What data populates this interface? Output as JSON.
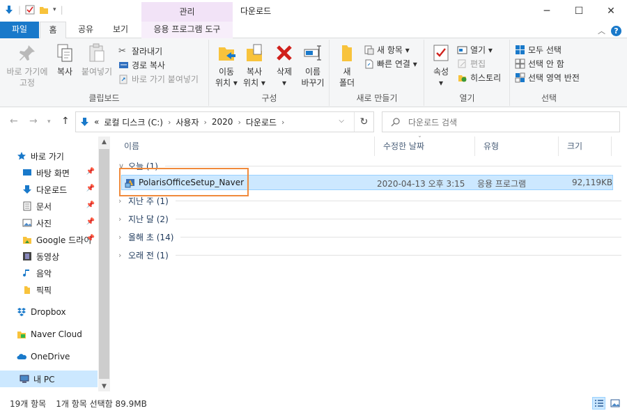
{
  "titlebar": {
    "title": "다운로드",
    "context_tab_header": "관리",
    "controls": {
      "minimize": "─",
      "maximize": "☐",
      "close": "✕"
    }
  },
  "tabs": [
    {
      "label": "파일"
    },
    {
      "label": "홈"
    },
    {
      "label": "공유"
    },
    {
      "label": "보기"
    },
    {
      "label": "응용 프로그램 도구"
    }
  ],
  "ribbon": {
    "clipboard": {
      "label": "클립보드",
      "pin_quick_access": [
        "바로 가기에",
        "고정"
      ],
      "copy": "복사",
      "paste": "붙여넣기",
      "cut": "잘라내기",
      "copy_path": "경로 복사",
      "paste_shortcut": "바로 가기 붙여넣기"
    },
    "organize": {
      "label": "구성",
      "move_to": [
        "이동",
        "위치 ▾"
      ],
      "copy_to": [
        "복사",
        "위치 ▾"
      ],
      "delete": [
        "삭제",
        "▾"
      ],
      "rename": [
        "이름",
        "바꾸기"
      ]
    },
    "new": {
      "label": "새로 만들기",
      "new_folder": [
        "새",
        "폴더"
      ],
      "new_item": "새 항목 ▾",
      "easy_access": "빠른 연결 ▾"
    },
    "open": {
      "label": "열기",
      "properties": [
        "속성",
        "▾"
      ],
      "open": "열기 ▾",
      "edit": "편집",
      "history": "히스토리"
    },
    "select": {
      "label": "선택",
      "select_all": "모두 선택",
      "select_none": "선택 안 함",
      "invert": "선택 영역 반전"
    }
  },
  "address": {
    "path_prefix": "«",
    "crumbs": [
      "로컬 디스크 (C:)",
      "사용자",
      "2020",
      "다운로드"
    ],
    "search_placeholder": "다운로드 검색"
  },
  "nav": {
    "items": [
      {
        "label": "바로 가기",
        "icon": "star-icon",
        "pinned": false
      },
      {
        "label": "바탕 화면",
        "icon": "desktop-icon",
        "pinned": true
      },
      {
        "label": "다운로드",
        "icon": "download-icon",
        "pinned": true
      },
      {
        "label": "문서",
        "icon": "document-icon",
        "pinned": true
      },
      {
        "label": "사진",
        "icon": "picture-icon",
        "pinned": true
      },
      {
        "label": "Google 드라이",
        "icon": "folder-icon",
        "pinned": true
      },
      {
        "label": "동영상",
        "icon": "video-icon",
        "pinned": false
      },
      {
        "label": "음악",
        "icon": "music-icon",
        "pinned": false
      },
      {
        "label": "픽픽",
        "icon": "folder-icon",
        "pinned": false
      },
      {
        "label": "Dropbox",
        "icon": "dropbox-icon",
        "pinned": false
      },
      {
        "label": "Naver Cloud",
        "icon": "folder-icon",
        "pinned": false
      },
      {
        "label": "OneDrive",
        "icon": "cloud-icon",
        "pinned": false
      },
      {
        "label": "내 PC",
        "icon": "pc-icon",
        "pinned": false
      }
    ]
  },
  "columns": [
    "이름",
    "수정한 날짜",
    "유형",
    "크기"
  ],
  "groups": [
    {
      "label": "오늘 (1)",
      "expanded": true
    },
    {
      "label": "지난 주 (1)",
      "expanded": false
    },
    {
      "label": "지난 달 (2)",
      "expanded": false
    },
    {
      "label": "올해 초 (14)",
      "expanded": false
    },
    {
      "label": "오래 전 (1)",
      "expanded": false
    }
  ],
  "files": [
    {
      "name": "PolarisOfficeSetup_Naver",
      "modified": "2020-04-13 오후 3:15",
      "type": "응용 프로그램",
      "size": "92,119KB"
    }
  ],
  "status": {
    "item_count": "19개 항목",
    "selection": "1개 항목 선택함 89.9MB"
  },
  "colors": {
    "accent": "#1979ca",
    "selection_bg": "#cce8ff",
    "context_tab": "#f2e3f7",
    "highlight_box": "#f08a3c"
  }
}
